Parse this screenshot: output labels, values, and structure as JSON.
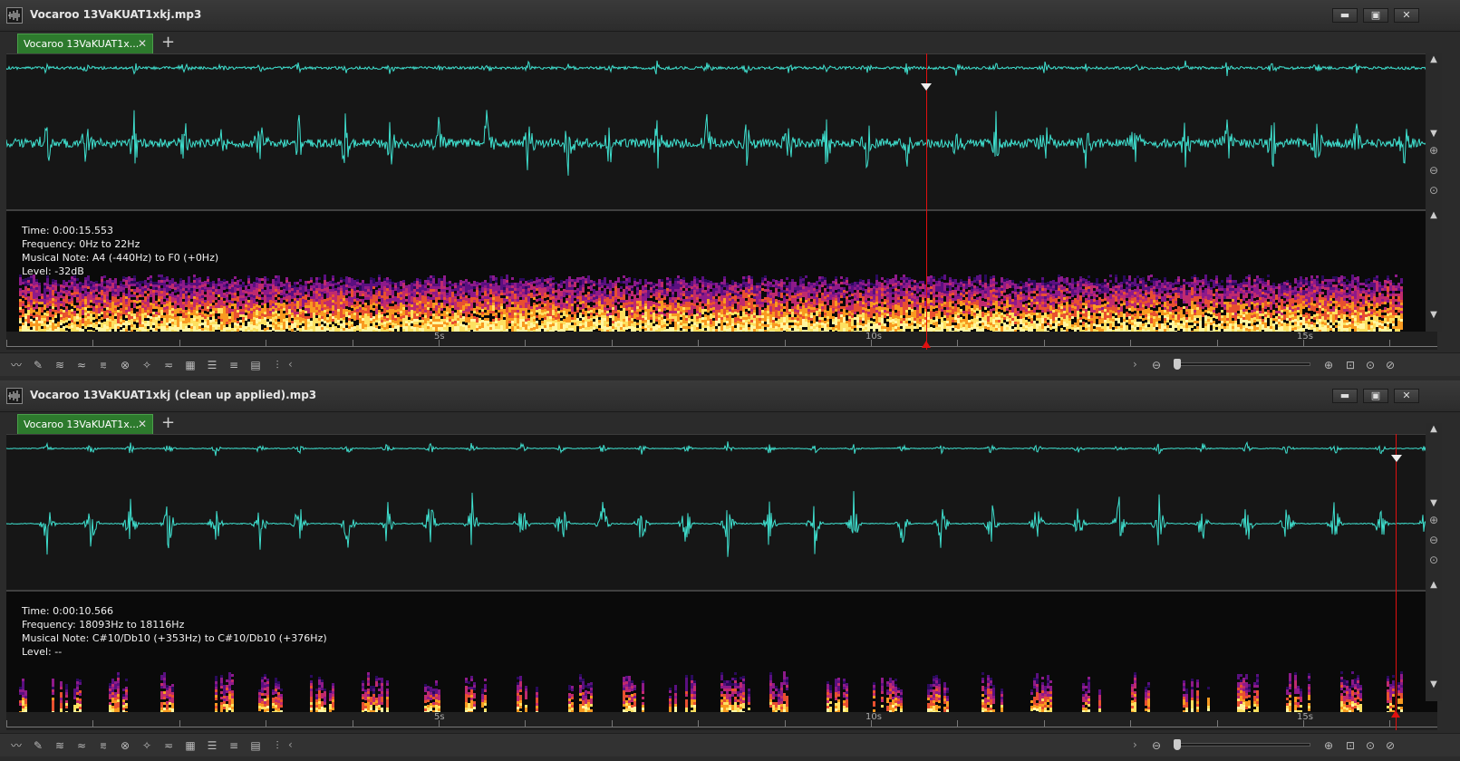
{
  "panels": [
    {
      "title": "Vocaroo 13VaKUAT1xkj.mp3",
      "tab_label": "Vocaroo 13VaKUAT1x...",
      "info": {
        "time": "Time: 0:00:15.553",
        "frequency": "Frequency: 0Hz to 22Hz",
        "note": "Musical Note: A4 (-440Hz) to F0 (+0Hz)",
        "level": "Level: -32dB"
      },
      "ruler_labels": [
        "5s",
        "10s",
        "15s"
      ],
      "cursor_time_s": 11.0
    },
    {
      "title": "Vocaroo 13VaKUAT1xkj (clean up applied).mp3",
      "tab_label": "Vocaroo 13VaKUAT1x...",
      "info": {
        "time": "Time: 0:00:10.566",
        "frequency": "Frequency: 18093Hz to 18116Hz",
        "note": "Musical Note: C#10/Db10 (+353Hz) to C#10/Db10 (+376Hz)",
        "level": "Level: --"
      },
      "ruler_labels": [
        "5s",
        "10s",
        "15s"
      ],
      "cursor_time_s": 16.3
    }
  ],
  "window_buttons": {
    "minimize": "▬",
    "maximize": "▣",
    "close": "✕"
  },
  "tab_close": "✕",
  "tab_add": "+",
  "colors": {
    "waveform": "#3fe0cf",
    "cursor": "#e01010",
    "tab_active": "#2d7a2d"
  }
}
